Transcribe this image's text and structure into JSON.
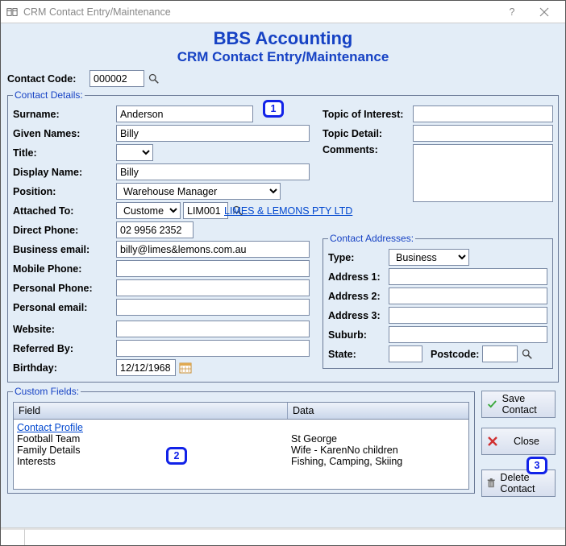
{
  "window": {
    "title": "CRM Contact Entry/Maintenance"
  },
  "header": {
    "title": "BBS Accounting",
    "subtitle": "CRM Contact Entry/Maintenance"
  },
  "contact_code": {
    "label": "Contact Code:",
    "value": "000002"
  },
  "details": {
    "legend": "Contact Details:",
    "surname": {
      "label": "Surname:",
      "value": "Anderson"
    },
    "given_names": {
      "label": "Given Names:",
      "value": "Billy"
    },
    "title": {
      "label": "Title:",
      "value": ""
    },
    "display_name": {
      "label": "Display Name:",
      "value": "Billy"
    },
    "position": {
      "label": "Position:",
      "value": "Warehouse Manager"
    },
    "attached_to": {
      "label": "Attached To:",
      "type": "Customer",
      "code": "LIM001",
      "link": "LIMES & LEMONS PTY LTD"
    },
    "direct_phone": {
      "label": "Direct Phone:",
      "value": "02 9956 2352"
    },
    "business_email": {
      "label": "Business email:",
      "value": "billy@limes&lemons.com.au"
    },
    "mobile_phone": {
      "label": "Mobile Phone:",
      "value": ""
    },
    "personal_phone": {
      "label": "Personal Phone:",
      "value": ""
    },
    "personal_email": {
      "label": "Personal email:",
      "value": ""
    },
    "website": {
      "label": "Website:",
      "value": ""
    },
    "referred_by": {
      "label": "Referred By:",
      "value": ""
    },
    "birthday": {
      "label": "Birthday:",
      "value": "12/12/1968"
    },
    "topic_of_interest": {
      "label": "Topic of Interest:",
      "value": ""
    },
    "topic_detail": {
      "label": "Topic Detail:",
      "value": ""
    },
    "comments": {
      "label": "Comments:",
      "value": ""
    }
  },
  "addresses": {
    "legend": "Contact Addresses:",
    "type": {
      "label": "Type:",
      "value": "Business"
    },
    "address1": {
      "label": "Address 1:",
      "value": ""
    },
    "address2": {
      "label": "Address 2:",
      "value": ""
    },
    "address3": {
      "label": "Address 3:",
      "value": ""
    },
    "suburb": {
      "label": "Suburb:",
      "value": ""
    },
    "state": {
      "label": "State:",
      "value": ""
    },
    "postcode": {
      "label": "Postcode:",
      "value": ""
    }
  },
  "custom_fields": {
    "legend": "Custom Fields:",
    "col_field": "Field",
    "col_data": "Data",
    "rows": [
      {
        "field": "Contact Profile",
        "data": "",
        "link": true
      },
      {
        "field": "Football Team",
        "data": "St George"
      },
      {
        "field": "Family Details",
        "data": "Wife - KarenNo children"
      },
      {
        "field": "Interests",
        "data": "Fishing, Camping, Skiing"
      }
    ]
  },
  "actions": {
    "save": "Save Contact",
    "close": "Close",
    "delete": "Delete Contact"
  },
  "callouts": {
    "one": "1",
    "two": "2",
    "three": "3"
  }
}
